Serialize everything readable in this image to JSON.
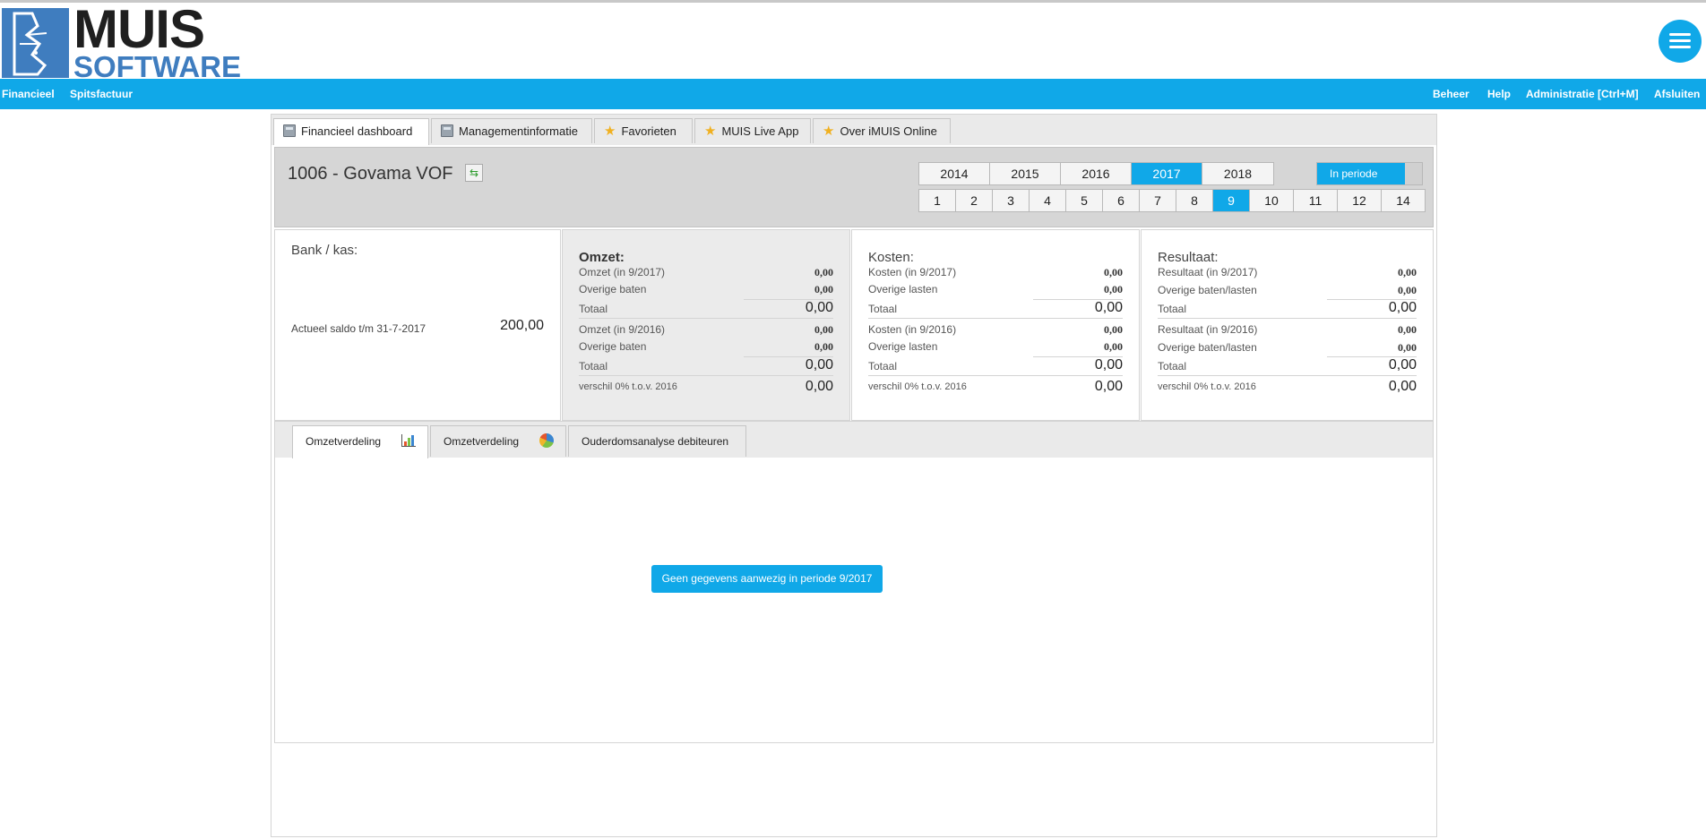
{
  "header": {
    "logo_text_1": "MUIS",
    "logo_text_2": "SOFTWARE"
  },
  "nav": {
    "left": [
      "Financieel",
      "Spitsfactuur"
    ],
    "right": [
      "Beheer",
      "Help",
      "Administratie [Ctrl+M]",
      "Afsluiten"
    ]
  },
  "tabs": [
    {
      "label": "Financieel dashboard",
      "icon": "calculator-icon"
    },
    {
      "label": "Managementinformatie",
      "icon": "calculator-icon"
    },
    {
      "label": "Favorieten",
      "icon": "star-icon"
    },
    {
      "label": "MUIS Live App",
      "icon": "star-icon"
    },
    {
      "label": "Over iMUIS Online",
      "icon": "star-icon"
    }
  ],
  "company": {
    "title": "1006 - Govama VOF",
    "years": [
      "2014",
      "2015",
      "2016",
      "2017",
      "2018"
    ],
    "selected_year": "2017",
    "periods": [
      "1",
      "2",
      "3",
      "4",
      "5",
      "6",
      "7",
      "8",
      "9",
      "10",
      "11",
      "12",
      "14"
    ],
    "selected_period": "9",
    "mode_toggle": "In periode"
  },
  "bank": {
    "title": "Bank / kas:",
    "saldo_label": "Actueel saldo t/m 31-7-2017",
    "saldo_value": "200,00"
  },
  "omzet": {
    "title": "Omzet:",
    "cur_label": "Omzet (in 9/2017)",
    "cur_value": "0,00",
    "cur_other_label": "Overige baten",
    "cur_other_value": "0,00",
    "cur_total_label": "Totaal",
    "cur_total_value": "0,00",
    "prev_label": "Omzet (in 9/2016)",
    "prev_value": "0,00",
    "prev_other_label": "Overige baten",
    "prev_other_value": "0,00",
    "prev_total_label": "Totaal",
    "prev_total_value": "0,00",
    "diff_label": "verschil 0% t.o.v. 2016",
    "diff_value": "0,00"
  },
  "kosten": {
    "title": "Kosten:",
    "cur_label": "Kosten (in 9/2017)",
    "cur_value": "0,00",
    "cur_other_label": "Overige lasten",
    "cur_other_value": "0,00",
    "cur_total_label": "Totaal",
    "cur_total_value": "0,00",
    "prev_label": "Kosten (in 9/2016)",
    "prev_value": "0,00",
    "prev_other_label": "Overige lasten",
    "prev_other_value": "0,00",
    "prev_total_label": "Totaal",
    "prev_total_value": "0,00",
    "diff_label": "verschil 0% t.o.v. 2016",
    "diff_value": "0,00"
  },
  "resultaat": {
    "title": "Resultaat:",
    "cur_label": "Resultaat (in 9/2017)",
    "cur_value": "0,00",
    "cur_other_label": "Overige baten/lasten",
    "cur_other_value": "0,00",
    "cur_total_label": "Totaal",
    "cur_total_value": "0,00",
    "prev_label": "Resultaat (in 9/2016)",
    "prev_value": "0,00",
    "prev_other_label": "Overige baten/lasten",
    "prev_other_value": "0,00",
    "prev_total_label": "Totaal",
    "prev_total_value": "0,00",
    "diff_label": "verschil 0% t.o.v. 2016",
    "diff_value": "0,00"
  },
  "chart_tabs": [
    {
      "label": "Omzetverdeling",
      "icon": "bar-chart-icon"
    },
    {
      "label": "Omzetverdeling",
      "icon": "pie-chart-icon"
    },
    {
      "label": "Ouderdomsanalyse debiteuren",
      "icon": ""
    }
  ],
  "no_data_message": "Geen gegevens aanwezig in periode 9/2017",
  "colors": {
    "accent": "#10a8e8",
    "logo_blue": "#3f7dbf"
  }
}
